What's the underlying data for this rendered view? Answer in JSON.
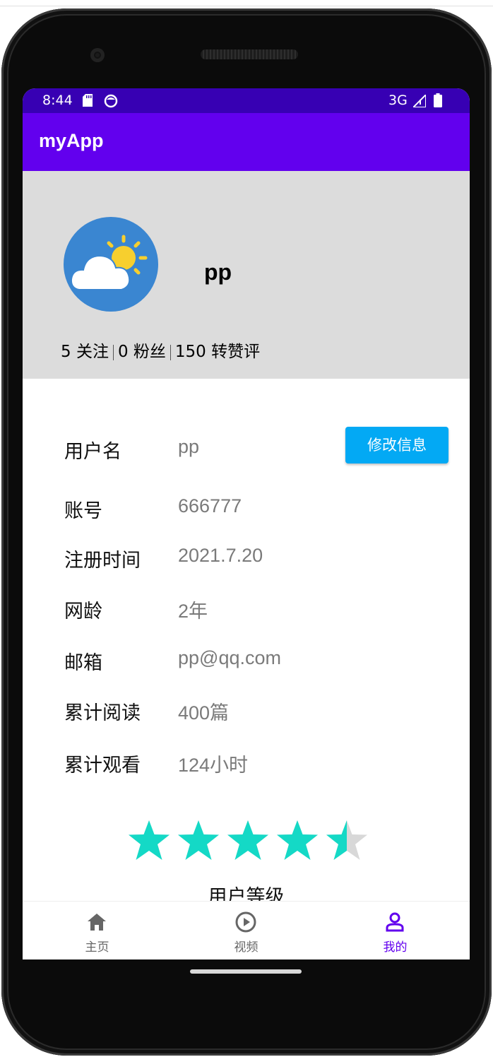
{
  "status_bar": {
    "time": "8:44",
    "network": "3G",
    "icons": [
      "sd-card-icon",
      "face-icon",
      "signal-icon",
      "battery-icon"
    ]
  },
  "app_bar": {
    "title": "myApp",
    "color": "#6200ee"
  },
  "profile": {
    "avatar_icon": "weather-cloud-sun-icon",
    "name": "pp",
    "stats": {
      "following": "5 关注",
      "fans": "0 粉丝",
      "likes": "150 转赞评"
    }
  },
  "info": {
    "edit_button": "修改信息",
    "rows": [
      {
        "label": "用户名",
        "value": "pp"
      },
      {
        "label": "账号",
        "value": "666777"
      },
      {
        "label": "注册时间",
        "value": "2021.7.20"
      },
      {
        "label": "网龄",
        "value": "2年"
      },
      {
        "label": "邮箱",
        "value": "pp@qq.com"
      },
      {
        "label": "累计阅读",
        "value": "400篇"
      },
      {
        "label": "累计观看",
        "value": "124小时"
      }
    ]
  },
  "rating": {
    "value": 4.5,
    "max": 5,
    "color": "#14d9c6",
    "label": "用户等级"
  },
  "bottom_nav": {
    "items": [
      {
        "label": "主页",
        "icon": "home-icon"
      },
      {
        "label": "视频",
        "icon": "play-circle-icon"
      },
      {
        "label": "我的",
        "icon": "person-icon",
        "active": true
      }
    ],
    "active_color": "#6200ee"
  }
}
